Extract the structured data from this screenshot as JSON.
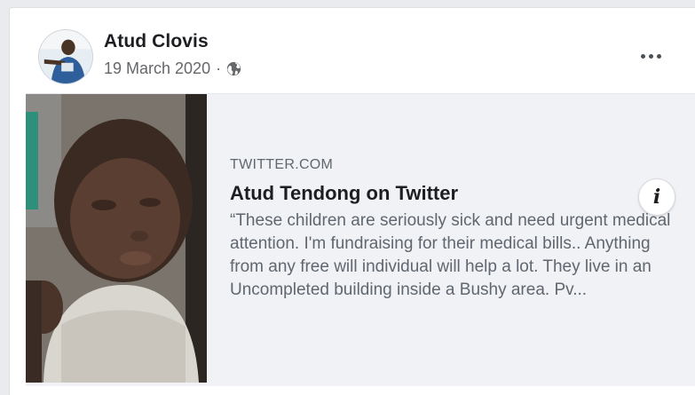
{
  "post": {
    "author": "Atud Clovis",
    "date": "19 March 2020",
    "separator": "·",
    "privacy_icon": "globe-icon",
    "more_icon": "more-options-icon"
  },
  "link_preview": {
    "domain": "TWITTER.COM",
    "title": "Atud Tendong on Twitter",
    "snippet": "“These children are seriously sick and need urgent medical attention. I'm fundraising for their medical bills.. Anything from any free will individual will help a lot. They live in an Uncompleted building inside a Bushy area. Pv...",
    "info_icon": "i"
  },
  "colors": {
    "card_background": "#ffffff",
    "preview_background": "#f0f2f5",
    "text_primary": "#1c1e21",
    "text_secondary": "#606770"
  }
}
